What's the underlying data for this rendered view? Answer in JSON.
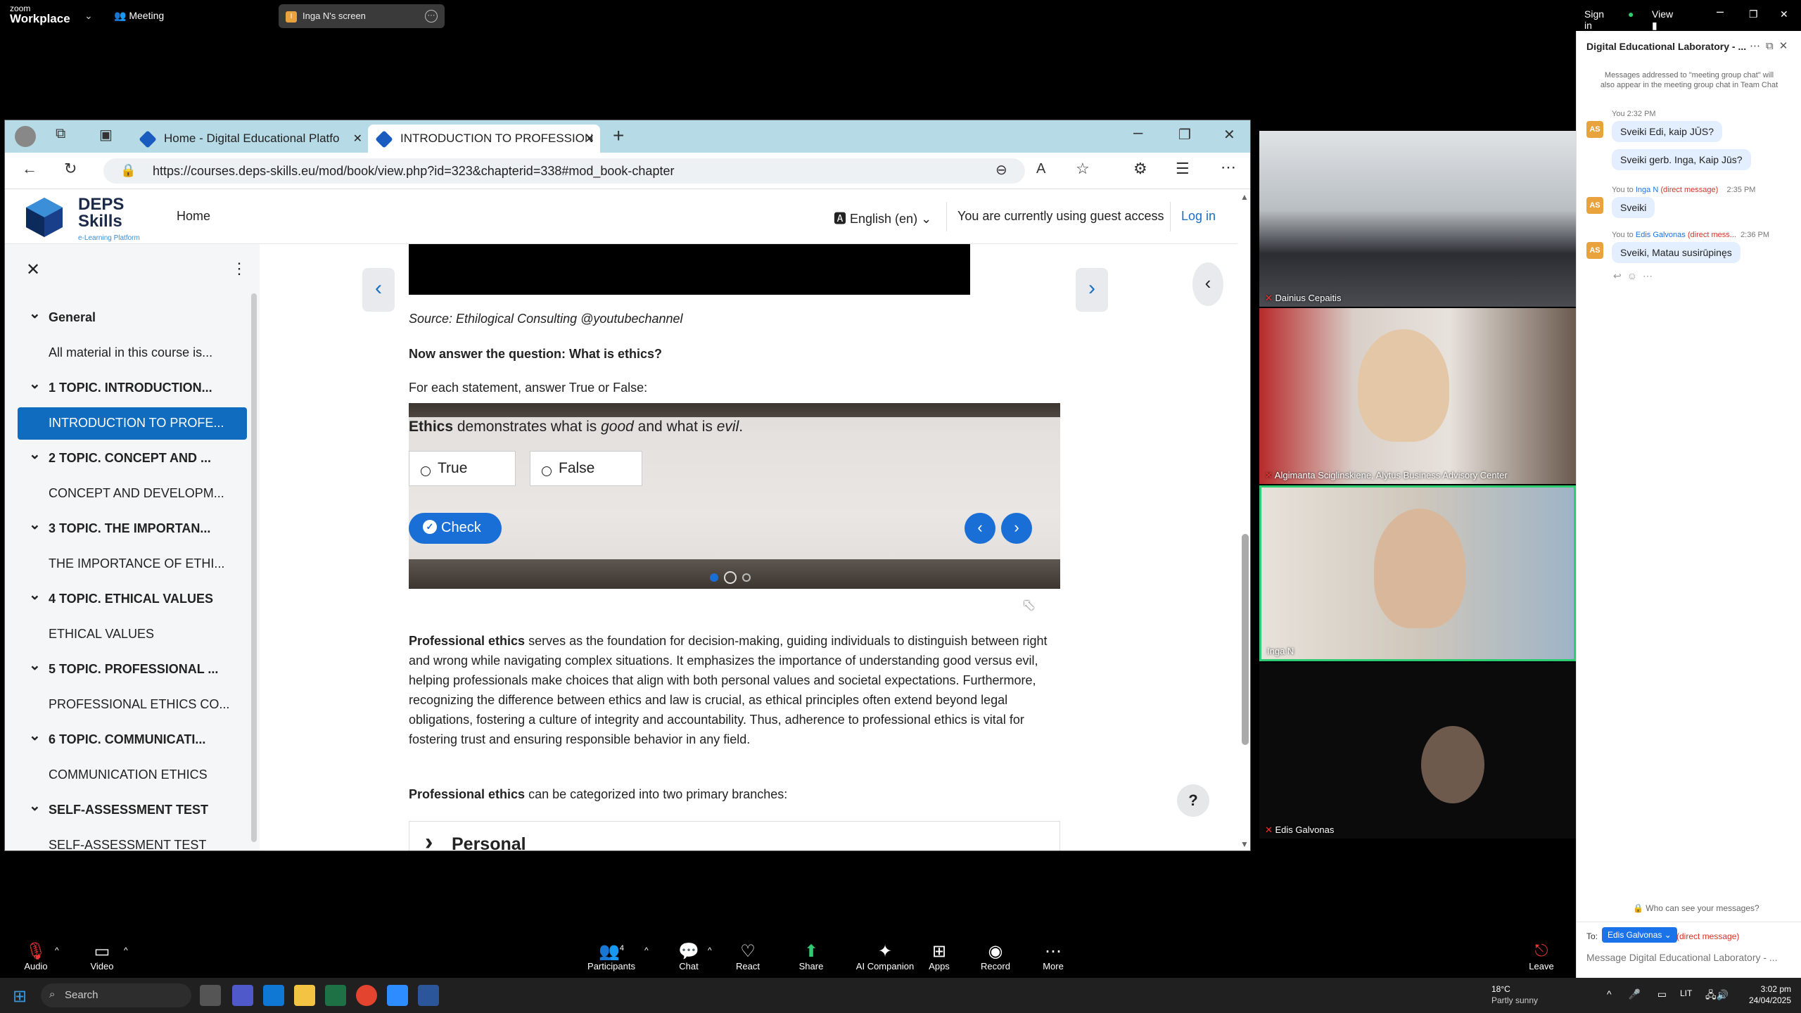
{
  "zoom": {
    "brand_top": "zoom",
    "brand_bottom": "Workplace",
    "meeting_label": "Meeting",
    "screen_tab": "Inga N's screen",
    "signin": "Sign in",
    "view": "View"
  },
  "browser": {
    "tabs": [
      {
        "label": "Home - Digital Educational Platfo"
      },
      {
        "label": "INTRODUCTION TO PROFESSION"
      }
    ],
    "url": "https://courses.deps-skills.eu/mod/book/view.php?id=323&chapterid=338#mod_book-chapter"
  },
  "moodle": {
    "brand_line1": "DEPS",
    "brand_line2": "Skills",
    "brand_sub": "e-Learning Platform",
    "home": "Home",
    "language": "English (en)",
    "guest_notice": "You are currently using guest access",
    "login": "Log in"
  },
  "sidebar": {
    "items": [
      {
        "label": "General"
      },
      {
        "label": "All material in this course is..."
      },
      {
        "label": "1 TOPIC. INTRODUCTION..."
      },
      {
        "label": "INTRODUCTION TO PROFE..."
      },
      {
        "label": "2 TOPIC. CONCEPT AND ..."
      },
      {
        "label": "CONCEPT AND DEVELOPM..."
      },
      {
        "label": "3 TOPIC. THE IMPORTAN..."
      },
      {
        "label": "THE IMPORTANCE OF ETHI..."
      },
      {
        "label": "4 TOPIC. ETHICAL VALUES"
      },
      {
        "label": "ETHICAL VALUES"
      },
      {
        "label": "5 TOPIC. PROFESSIONAL ..."
      },
      {
        "label": "PROFESSIONAL ETHICS CO..."
      },
      {
        "label": "6 TOPIC. COMMUNICATI..."
      },
      {
        "label": "COMMUNICATION ETHICS"
      },
      {
        "label": "SELF-ASSESSMENT TEST"
      },
      {
        "label": "SELF-ASSESSMENT TEST"
      }
    ]
  },
  "content": {
    "source": "Source: Ethilogical Consulting @youtubechannel",
    "question": "Now answer the question: What is ethics?",
    "instruction": "For each statement, answer True or False:",
    "quiz": {
      "stmt_bold": "Ethics",
      "stmt_a": " demonstrates what is ",
      "stmt_good": "good",
      "stmt_b": " and what is ",
      "stmt_evil": "evil",
      "stmt_end": ".",
      "option_true": "True",
      "option_false": "False",
      "check": "Check"
    },
    "para1_bold": "Professional ethics",
    "para1": " serves as the foundation for decision-making, guiding individuals to distinguish between right and wrong while navigating complex situations. It emphasizes the importance of understanding good versus evil, helping professionals make choices that align with both personal values and societal expectations. Furthermore, recognizing the difference between ethics and law is crucial, as ethical principles often extend beyond legal obligations, fostering a culture of integrity and accountability. Thus, adherence to professional ethics is vital for fostering trust and ensuring responsible behavior in any field.",
    "para2_bold": "Professional ethics",
    "para2": " can be categorized into two primary branches:",
    "accordion": "Personal",
    "help": "?"
  },
  "participants": [
    {
      "name": "Dainius Cepaitis"
    },
    {
      "name": "Algimanta Sciglinskiene, Alytus Business Advisory Center"
    },
    {
      "name": "Inga N"
    },
    {
      "name": "Edis Galvonas"
    }
  ],
  "chat": {
    "title": "Digital Educational Laboratory - ...",
    "notice": "Messages addressed to \"meeting group chat\" will also appear in the meeting group chat in Team Chat",
    "messages": [
      {
        "meta": "You 2:32 PM",
        "text": "Sveiki Edi, kaip JŪS?"
      },
      {
        "meta": "",
        "text": "Sveiki gerb. Inga, Kaip Jūs?"
      },
      {
        "meta_you": "You to ",
        "meta_to": "Inga N",
        "meta_dm": "(direct message)",
        "meta_time": "2:35 PM",
        "text": "Sveiki"
      },
      {
        "meta_you": "You to ",
        "meta_to": "Edis Galvonas",
        "meta_dm": "(direct mess...",
        "meta_time": "2:36 PM",
        "text": "Sveiki, Matau susirūpinęs"
      }
    ],
    "avatar": "AS",
    "who_can_see": "Who can see your messages?",
    "to_label": "To:",
    "to_chip": "Edis Galvonas",
    "to_dm": "(direct message)",
    "input_placeholder": "Message Digital Educational Laboratory - ..."
  },
  "toolbar": {
    "audio": "Audio",
    "video": "Video",
    "participants": "Participants",
    "participants_count": "4",
    "chat": "Chat",
    "react": "React",
    "share": "Share",
    "ai": "AI Companion",
    "apps": "Apps",
    "record": "Record",
    "more": "More",
    "leave": "Leave"
  },
  "taskbar": {
    "search": "Search",
    "temp": "18°C",
    "weather": "Partly sunny",
    "lang": "LIT",
    "time": "3:02 pm",
    "date": "24/04/2025"
  }
}
